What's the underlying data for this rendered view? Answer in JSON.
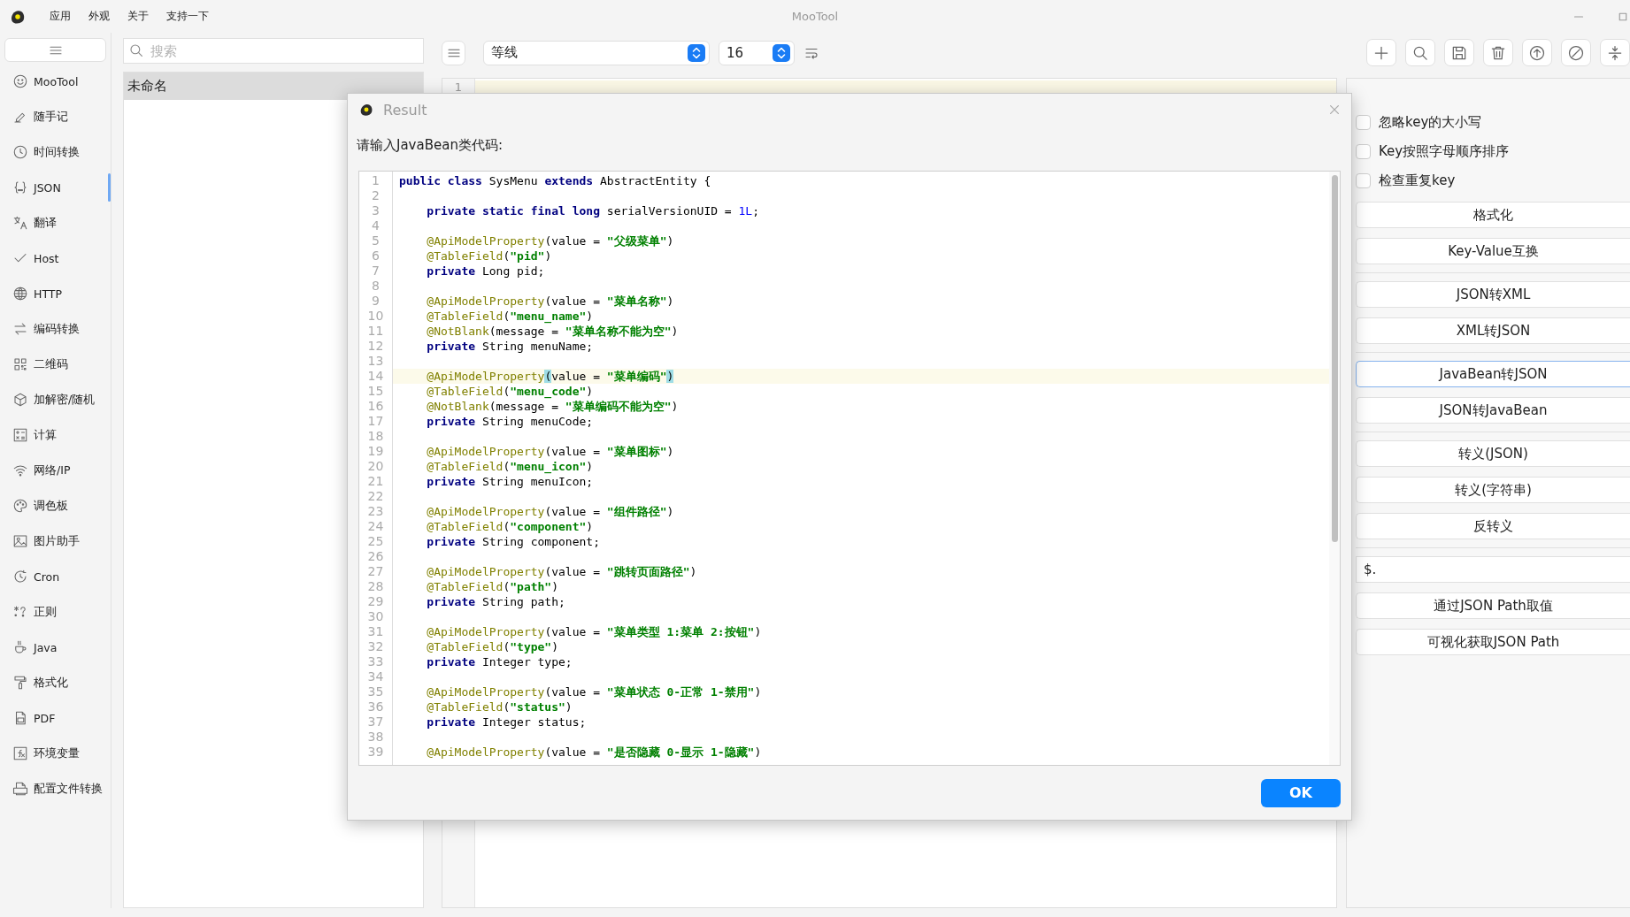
{
  "app": {
    "title": "MooTool",
    "menu": [
      "应用",
      "外观",
      "关于",
      "支持一下"
    ]
  },
  "sidebar": {
    "items": [
      {
        "label": "MooTool",
        "selected": false
      },
      {
        "label": "随手记",
        "selected": false
      },
      {
        "label": "时间转换",
        "selected": false
      },
      {
        "label": "JSON",
        "selected": true
      },
      {
        "label": "翻译",
        "selected": false
      },
      {
        "label": "Host",
        "selected": false
      },
      {
        "label": "HTTP",
        "selected": false
      },
      {
        "label": "编码转换",
        "selected": false
      },
      {
        "label": "二维码",
        "selected": false
      },
      {
        "label": "加解密/随机",
        "selected": false
      },
      {
        "label": "计算",
        "selected": false
      },
      {
        "label": "网络/IP",
        "selected": false
      },
      {
        "label": "调色板",
        "selected": false
      },
      {
        "label": "图片助手",
        "selected": false
      },
      {
        "label": "Cron",
        "selected": false
      },
      {
        "label": "正则",
        "selected": false
      },
      {
        "label": "Java",
        "selected": false
      },
      {
        "label": "格式化",
        "selected": false
      },
      {
        "label": "PDF",
        "selected": false
      },
      {
        "label": "环境变量",
        "selected": false
      },
      {
        "label": "配置文件转换",
        "selected": false
      }
    ]
  },
  "note_list": {
    "search": {
      "placeholder": "搜索"
    },
    "items": [
      {
        "label": "未命名",
        "selected": true
      }
    ]
  },
  "toolbar": {
    "font": {
      "value": "等线"
    },
    "font_size": {
      "value": "16"
    }
  },
  "editor": {
    "lines": [
      {
        "number": "1",
        "current": true
      }
    ]
  },
  "options": {
    "checkboxes": [
      {
        "label": "忽略key的大小写",
        "checked": false
      },
      {
        "label": "Key按照字母顺序排序",
        "checked": false
      },
      {
        "label": "检查重复key",
        "checked": false
      }
    ],
    "groups": [
      [
        {
          "kind": "button",
          "label": "格式化",
          "focused": false
        },
        {
          "kind": "button",
          "label": "Key-Value互换",
          "focused": false
        }
      ],
      [
        {
          "kind": "button",
          "label": "JSON转XML",
          "focused": false
        },
        {
          "kind": "button",
          "label": "XML转JSON",
          "focused": false
        }
      ],
      [
        {
          "kind": "button",
          "label": "JavaBean转JSON",
          "focused": true
        },
        {
          "kind": "button",
          "label": "JSON转JavaBean",
          "focused": false
        }
      ],
      [
        {
          "kind": "button",
          "label": "转义(JSON)",
          "focused": false
        },
        {
          "kind": "button",
          "label": "转义(字符串)",
          "focused": false
        },
        {
          "kind": "button",
          "label": "反转义",
          "focused": false
        }
      ],
      [
        {
          "kind": "field",
          "label": "$.",
          "focused": false
        },
        {
          "kind": "button",
          "label": "通过JSON Path取值",
          "focused": false
        },
        {
          "kind": "button",
          "label": "可视化获取JSON Path",
          "focused": false
        }
      ]
    ]
  },
  "dialog": {
    "title": "Result",
    "prompt": "请输入JavaBean类代码:",
    "ok": "OK",
    "code": [
      {
        "number": "1",
        "current": false,
        "tokens": [
          {
            "kind": "keyword",
            "t": "public class"
          },
          {
            "kind": "plain",
            "t": " SysMenu "
          },
          {
            "kind": "keyword",
            "t": "extends"
          },
          {
            "kind": "plain",
            "t": " AbstractEntity {"
          }
        ]
      },
      {
        "number": "2",
        "current": false
      },
      {
        "number": "3",
        "current": false,
        "tokens": [
          {
            "kind": "keyword",
            "t": "    private static final long"
          },
          {
            "kind": "plain",
            "t": " serialVersionUID = "
          },
          {
            "kind": "number",
            "t": "1L"
          },
          {
            "kind": "plain",
            "t": ";"
          }
        ]
      },
      {
        "number": "4",
        "current": false
      },
      {
        "number": "5",
        "current": false,
        "tokens": [
          {
            "kind": "annotation",
            "t": "    @ApiModelProperty"
          },
          {
            "kind": "plain",
            "t": "(value = "
          },
          {
            "kind": "string",
            "t": "\"父级菜单\""
          },
          {
            "kind": "plain",
            "t": ")"
          }
        ]
      },
      {
        "number": "6",
        "current": false,
        "tokens": [
          {
            "kind": "annotation",
            "t": "    @TableField"
          },
          {
            "kind": "plain",
            "t": "("
          },
          {
            "kind": "string",
            "t": "\"pid\""
          },
          {
            "kind": "plain",
            "t": ")"
          }
        ]
      },
      {
        "number": "7",
        "current": false,
        "tokens": [
          {
            "kind": "keyword",
            "t": "    private"
          },
          {
            "kind": "plain",
            "t": " Long pid;"
          }
        ]
      },
      {
        "number": "8",
        "current": false
      },
      {
        "number": "9",
        "current": false,
        "tokens": [
          {
            "kind": "annotation",
            "t": "    @ApiModelProperty"
          },
          {
            "kind": "plain",
            "t": "(value = "
          },
          {
            "kind": "string",
            "t": "\"菜单名称\""
          },
          {
            "kind": "plain",
            "t": ")"
          }
        ]
      },
      {
        "number": "10",
        "current": false,
        "tokens": [
          {
            "kind": "annotation",
            "t": "    @TableField"
          },
          {
            "kind": "plain",
            "t": "("
          },
          {
            "kind": "string",
            "t": "\"menu_name\""
          },
          {
            "kind": "plain",
            "t": ")"
          }
        ]
      },
      {
        "number": "11",
        "current": false,
        "tokens": [
          {
            "kind": "annotation",
            "t": "    @NotBlank"
          },
          {
            "kind": "plain",
            "t": "(message = "
          },
          {
            "kind": "string",
            "t": "\"菜单名称不能为空\""
          },
          {
            "kind": "plain",
            "t": ")"
          }
        ]
      },
      {
        "number": "12",
        "current": false,
        "tokens": [
          {
            "kind": "keyword",
            "t": "    private"
          },
          {
            "kind": "plain",
            "t": " String menuName;"
          }
        ]
      },
      {
        "number": "13",
        "current": false
      },
      {
        "number": "14",
        "current": true,
        "tokens": [
          {
            "kind": "annotation",
            "t": "    @ApiModelProperty"
          },
          {
            "kind": "bracket",
            "t": "("
          },
          {
            "kind": "plain",
            "t": "value = "
          },
          {
            "kind": "string",
            "t": "\"菜单编码\""
          },
          {
            "kind": "bracket",
            "t": ")"
          }
        ]
      },
      {
        "number": "15",
        "current": false,
        "tokens": [
          {
            "kind": "annotation",
            "t": "    @TableField"
          },
          {
            "kind": "plain",
            "t": "("
          },
          {
            "kind": "string",
            "t": "\"menu_code\""
          },
          {
            "kind": "plain",
            "t": ")"
          }
        ]
      },
      {
        "number": "16",
        "current": false,
        "tokens": [
          {
            "kind": "annotation",
            "t": "    @NotBlank"
          },
          {
            "kind": "plain",
            "t": "(message = "
          },
          {
            "kind": "string",
            "t": "\"菜单编码不能为空\""
          },
          {
            "kind": "plain",
            "t": ")"
          }
        ]
      },
      {
        "number": "17",
        "current": false,
        "tokens": [
          {
            "kind": "keyword",
            "t": "    private"
          },
          {
            "kind": "plain",
            "t": " String menuCode;"
          }
        ]
      },
      {
        "number": "18",
        "current": false
      },
      {
        "number": "19",
        "current": false,
        "tokens": [
          {
            "kind": "annotation",
            "t": "    @ApiModelProperty"
          },
          {
            "kind": "plain",
            "t": "(value = "
          },
          {
            "kind": "string",
            "t": "\"菜单图标\""
          },
          {
            "kind": "plain",
            "t": ")"
          }
        ]
      },
      {
        "number": "20",
        "current": false,
        "tokens": [
          {
            "kind": "annotation",
            "t": "    @TableField"
          },
          {
            "kind": "plain",
            "t": "("
          },
          {
            "kind": "string",
            "t": "\"menu_icon\""
          },
          {
            "kind": "plain",
            "t": ")"
          }
        ]
      },
      {
        "number": "21",
        "current": false,
        "tokens": [
          {
            "kind": "keyword",
            "t": "    private"
          },
          {
            "kind": "plain",
            "t": " String menuIcon;"
          }
        ]
      },
      {
        "number": "22",
        "current": false
      },
      {
        "number": "23",
        "current": false,
        "tokens": [
          {
            "kind": "annotation",
            "t": "    @ApiModelProperty"
          },
          {
            "kind": "plain",
            "t": "(value = "
          },
          {
            "kind": "string",
            "t": "\"组件路径\""
          },
          {
            "kind": "plain",
            "t": ")"
          }
        ]
      },
      {
        "number": "24",
        "current": false,
        "tokens": [
          {
            "kind": "annotation",
            "t": "    @TableField"
          },
          {
            "kind": "plain",
            "t": "("
          },
          {
            "kind": "string",
            "t": "\"component\""
          },
          {
            "kind": "plain",
            "t": ")"
          }
        ]
      },
      {
        "number": "25",
        "current": false,
        "tokens": [
          {
            "kind": "keyword",
            "t": "    private"
          },
          {
            "kind": "plain",
            "t": " String component;"
          }
        ]
      },
      {
        "number": "26",
        "current": false
      },
      {
        "number": "27",
        "current": false,
        "tokens": [
          {
            "kind": "annotation",
            "t": "    @ApiModelProperty"
          },
          {
            "kind": "plain",
            "t": "(value = "
          },
          {
            "kind": "string",
            "t": "\"跳转页面路径\""
          },
          {
            "kind": "plain",
            "t": ")"
          }
        ]
      },
      {
        "number": "28",
        "current": false,
        "tokens": [
          {
            "kind": "annotation",
            "t": "    @TableField"
          },
          {
            "kind": "plain",
            "t": "("
          },
          {
            "kind": "string",
            "t": "\"path\""
          },
          {
            "kind": "plain",
            "t": ")"
          }
        ]
      },
      {
        "number": "29",
        "current": false,
        "tokens": [
          {
            "kind": "keyword",
            "t": "    private"
          },
          {
            "kind": "plain",
            "t": " String path;"
          }
        ]
      },
      {
        "number": "30",
        "current": false
      },
      {
        "number": "31",
        "current": false,
        "tokens": [
          {
            "kind": "annotation",
            "t": "    @ApiModelProperty"
          },
          {
            "kind": "plain",
            "t": "(value = "
          },
          {
            "kind": "string",
            "t": "\"菜单类型 1:菜单 2:按钮\""
          },
          {
            "kind": "plain",
            "t": ")"
          }
        ]
      },
      {
        "number": "32",
        "current": false,
        "tokens": [
          {
            "kind": "annotation",
            "t": "    @TableField"
          },
          {
            "kind": "plain",
            "t": "("
          },
          {
            "kind": "string",
            "t": "\"type\""
          },
          {
            "kind": "plain",
            "t": ")"
          }
        ]
      },
      {
        "number": "33",
        "current": false,
        "tokens": [
          {
            "kind": "keyword",
            "t": "    private"
          },
          {
            "kind": "plain",
            "t": " Integer type;"
          }
        ]
      },
      {
        "number": "34",
        "current": false
      },
      {
        "number": "35",
        "current": false,
        "tokens": [
          {
            "kind": "annotation",
            "t": "    @ApiModelProperty"
          },
          {
            "kind": "plain",
            "t": "(value = "
          },
          {
            "kind": "string",
            "t": "\"菜单状态 0-正常 1-禁用\""
          },
          {
            "kind": "plain",
            "t": ")"
          }
        ]
      },
      {
        "number": "36",
        "current": false,
        "tokens": [
          {
            "kind": "annotation",
            "t": "    @TableField"
          },
          {
            "kind": "plain",
            "t": "("
          },
          {
            "kind": "string",
            "t": "\"status\""
          },
          {
            "kind": "plain",
            "t": ")"
          }
        ]
      },
      {
        "number": "37",
        "current": false,
        "tokens": [
          {
            "kind": "keyword",
            "t": "    private"
          },
          {
            "kind": "plain",
            "t": " Integer status;"
          }
        ]
      },
      {
        "number": "38",
        "current": false
      },
      {
        "number": "39",
        "current": false,
        "tokens": [
          {
            "kind": "annotation",
            "t": "    @ApiModelProperty"
          },
          {
            "kind": "plain",
            "t": "(value = "
          },
          {
            "kind": "string",
            "t": "\"是否隐藏 0-显示 1-隐藏\""
          },
          {
            "kind": "plain",
            "t": ")"
          }
        ]
      }
    ]
  }
}
